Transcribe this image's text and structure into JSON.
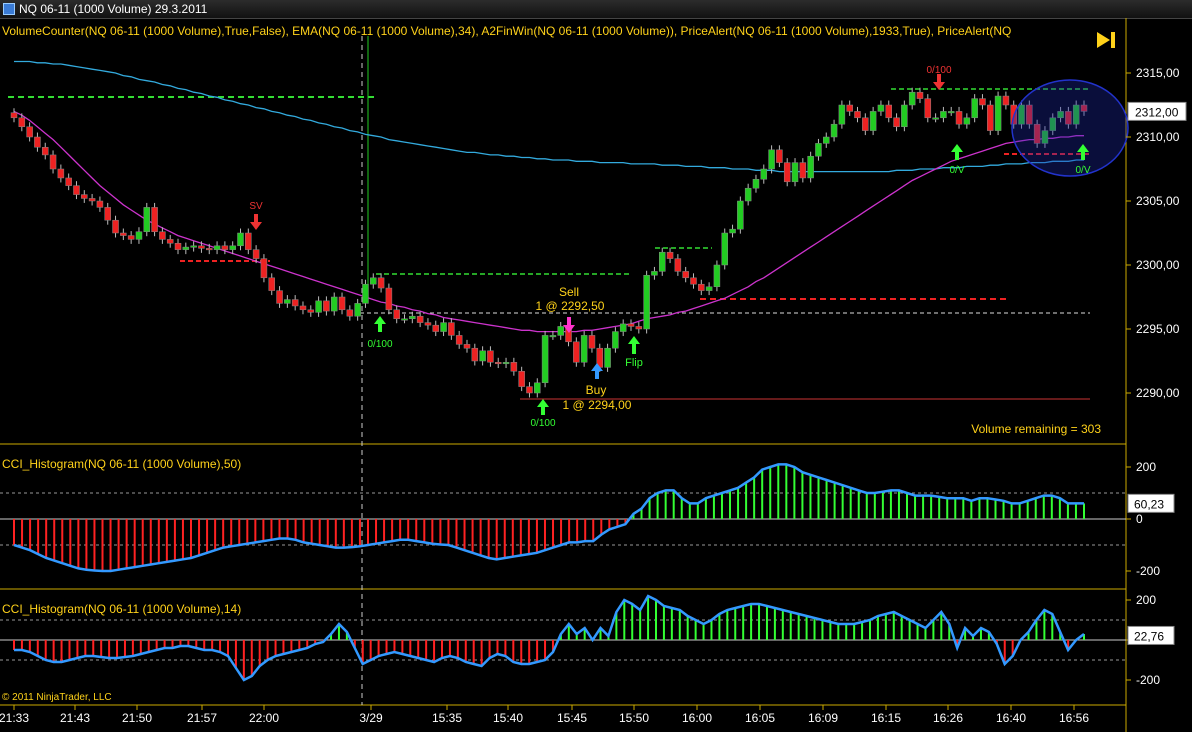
{
  "window": {
    "title": "NQ 06-11 (1000 Volume)  29.3.2011"
  },
  "panels": {
    "price_header": "VolumeCounter(NQ 06-11 (1000 Volume),True,False),  EMA(NQ 06-11 (1000 Volume),34),  A2FinWin(NQ 06-11 (1000 Volume)),  PriceAlert(NQ 06-11 (1000 Volume),1933,True),  PriceAlert(NQ",
    "cci50_header": "CCI_Histogram(NQ 06-11 (1000 Volume),50)",
    "cci14_header": "CCI_Histogram(NQ 06-11 (1000 Volume),14)",
    "copyright": "© 2011 NinjaTrader, LLC",
    "volume_remaining": "Volume remaining = 303"
  },
  "markers": {
    "sell_label": "Sell",
    "sell_detail": "1 @ 2292,50",
    "buy_label": "Buy",
    "buy_detail": "1 @ 2294,00",
    "flip": "Flip",
    "ov_a": "0/100",
    "ov_b": "0/100",
    "ov_c": "0/100",
    "ov_d": "0/V",
    "ov_e": "0/V",
    "sv": "SV"
  },
  "colors": {
    "bg": "#000000",
    "up_candle": "#22cc22",
    "down_candle": "#ee2222",
    "ema_fast": "#cc33cc",
    "ema_slow": "#33aadd",
    "cci_line": "#3399ff",
    "hist_pos": "#33ff33",
    "hist_neg": "#ff2222",
    "axis": "#ccaa00",
    "text": "#ffd21a"
  },
  "chart_data": [
    {
      "type": "candlestick",
      "panel": "price",
      "ylim": [
        2287,
        2317
      ],
      "y_ticks": [
        "2315,00",
        "2310,00",
        "2305,00",
        "2300,00",
        "2295,00",
        "2290,00"
      ],
      "last_price": "2312,00",
      "x_tick_labels": [
        "21:33",
        "21:43",
        "21:50",
        "21:57",
        "22:00",
        "3/29",
        "15:35",
        "15:40",
        "15:45",
        "15:50",
        "16:00",
        "16:05",
        "16:09",
        "16:15",
        "16:26",
        "16:40",
        "16:56"
      ],
      "closes": [
        2311.5,
        2310.8,
        2310.0,
        2309.2,
        2308.6,
        2307.5,
        2306.8,
        2306.2,
        2305.5,
        2305.2,
        2305.0,
        2304.5,
        2303.5,
        2302.5,
        2302.3,
        2302.0,
        2302.6,
        2304.5,
        2302.6,
        2302.0,
        2301.7,
        2301.2,
        2301.4,
        2301.5,
        2301.3,
        2301.2,
        2301.5,
        2301.2,
        2301.5,
        2302.5,
        2301.2,
        2300.5,
        2299.0,
        2298.0,
        2297.0,
        2297.3,
        2296.8,
        2296.5,
        2296.3,
        2297.2,
        2296.4,
        2297.5,
        2296.5,
        2296.0,
        2297.0,
        2298.5,
        2299.0,
        2298.2,
        2296.5,
        2295.8,
        2295.8,
        2296.0,
        2295.5,
        2295.3,
        2294.8,
        2295.5,
        2294.5,
        2293.8,
        2293.5,
        2292.5,
        2293.3,
        2292.4,
        2292.3,
        2292.4,
        2291.7,
        2290.5,
        2290.0,
        2290.8,
        2294.5,
        2294.5,
        2295.2,
        2294.0,
        2292.4,
        2294.5,
        2293.5,
        2292.0,
        2293.5,
        2294.8,
        2295.4,
        2295.2,
        2295.0,
        2299.2,
        2299.5,
        2301.0,
        2300.5,
        2299.5,
        2299.0,
        2298.5,
        2298.0,
        2298.3,
        2300.0,
        2302.5,
        2302.8,
        2305.0,
        2306.0,
        2306.7,
        2307.5,
        2309.0,
        2308.0,
        2306.5,
        2308.0,
        2306.8,
        2308.5,
        2309.5,
        2310.0,
        2311.0,
        2312.5,
        2312.0,
        2311.5,
        2310.5,
        2312.0,
        2312.5,
        2311.5,
        2310.8,
        2312.5,
        2313.5,
        2313.0,
        2311.5,
        2311.5,
        2312.0,
        2312.0,
        2311.0,
        2311.5,
        2313.0,
        2312.5,
        2310.5,
        2313.2,
        2312.5,
        2311.0,
        2312.5,
        2311.0,
        2309.5,
        2310.5,
        2311.5,
        2312.0,
        2311.0,
        2312.5,
        2312.0
      ],
      "ema_fast": [
        2312.0,
        2311.7,
        2311.3,
        2310.8,
        2310.3,
        2309.8,
        2309.2,
        2308.6,
        2308.0,
        2307.4,
        2306.8,
        2306.2,
        2305.7,
        2305.2,
        2304.7,
        2304.3,
        2303.9,
        2303.5,
        2303.2,
        2302.9,
        2302.6,
        2302.3,
        2302.1,
        2301.9,
        2301.7,
        2301.5,
        2301.3,
        2301.1,
        2300.9,
        2300.7,
        2300.5,
        2300.3,
        2300.1,
        2299.9,
        2299.7,
        2299.5,
        2299.3,
        2299.1,
        2298.9,
        2298.7,
        2298.5,
        2298.3,
        2298.1,
        2297.9,
        2297.7,
        2297.5,
        2297.3,
        2297.1,
        2297.0,
        2296.8,
        2296.7,
        2296.5,
        2296.4,
        2296.2,
        2296.1,
        2295.9,
        2295.8,
        2295.7,
        2295.6,
        2295.5,
        2295.4,
        2295.3,
        2295.2,
        2295.1,
        2295.0,
        2294.9,
        2294.9,
        2294.8,
        2294.8,
        2294.8,
        2294.8,
        2294.8,
        2294.8,
        2294.9,
        2294.9,
        2295.0,
        2295.1,
        2295.2,
        2295.3,
        2295.4,
        2295.6,
        2295.8,
        2295.9,
        2296.0,
        2296.1,
        2296.3,
        2296.4,
        2296.6,
        2296.8,
        2297.0,
        2297.2,
        2297.4,
        2297.7,
        2298.0,
        2298.3,
        2298.7,
        2299.0,
        2299.4,
        2299.8,
        2300.2,
        2300.6,
        2301.0,
        2301.4,
        2301.8,
        2302.2,
        2302.6,
        2303.0,
        2303.4,
        2303.8,
        2304.2,
        2304.6,
        2305.0,
        2305.4,
        2305.8,
        2306.2,
        2306.6,
        2306.9,
        2307.2,
        2307.5,
        2307.8,
        2308.1,
        2308.3,
        2308.5,
        2308.7,
        2308.9,
        2309.1,
        2309.3,
        2309.5,
        2309.6,
        2309.7,
        2309.8,
        2309.8,
        2309.9,
        2309.9,
        2310.0,
        2310.0,
        2310.1,
        2310.1
      ],
      "ema_slow": [
        2315.9,
        2315.9,
        2315.9,
        2315.8,
        2315.8,
        2315.7,
        2315.7,
        2315.6,
        2315.5,
        2315.4,
        2315.3,
        2315.2,
        2315.1,
        2315.0,
        2314.8,
        2314.7,
        2314.5,
        2314.4,
        2314.3,
        2314.1,
        2314.0,
        2313.8,
        2313.7,
        2313.5,
        2313.4,
        2313.2,
        2313.1,
        2312.9,
        2312.8,
        2312.6,
        2312.5,
        2312.3,
        2312.2,
        2312.0,
        2311.9,
        2311.7,
        2311.6,
        2311.4,
        2311.3,
        2311.1,
        2311.0,
        2310.8,
        2310.7,
        2310.5,
        2310.4,
        2310.2,
        2310.1,
        2310.0,
        2309.8,
        2309.7,
        2309.6,
        2309.5,
        2309.4,
        2309.3,
        2309.2,
        2309.1,
        2309.0,
        2308.9,
        2308.8,
        2308.8,
        2308.7,
        2308.6,
        2308.6,
        2308.5,
        2308.5,
        2308.4,
        2308.4,
        2308.3,
        2308.3,
        2308.2,
        2308.2,
        2308.2,
        2308.1,
        2308.1,
        2308.1,
        2308.0,
        2308.0,
        2308.0,
        2308.0,
        2307.9,
        2307.9,
        2307.9,
        2307.9,
        2307.8,
        2307.8,
        2307.8,
        2307.7,
        2307.7,
        2307.7,
        2307.6,
        2307.6,
        2307.6,
        2307.5,
        2307.5,
        2307.5,
        2307.4,
        2307.4,
        2307.4,
        2307.3,
        2307.3,
        2307.3,
        2307.3,
        2307.3,
        2307.3,
        2307.3,
        2307.3,
        2307.3,
        2307.3,
        2307.3,
        2307.3,
        2307.3,
        2307.3,
        2307.3,
        2307.4,
        2307.4,
        2307.4,
        2307.5,
        2307.5,
        2307.5,
        2307.6,
        2307.6,
        2307.6,
        2307.7,
        2307.7,
        2307.7,
        2307.8,
        2307.8,
        2307.9,
        2307.9,
        2307.9,
        2308.0,
        2308.0,
        2308.0,
        2308.1,
        2308.1,
        2308.1,
        2308.2,
        2308.2
      ]
    },
    {
      "type": "bar",
      "panel": "cci50",
      "ylim": [
        -250,
        250
      ],
      "y_ticks": [
        "200",
        "0",
        "-200"
      ],
      "last_value": "60,23",
      "values": [
        -100,
        -110,
        -120,
        -135,
        -150,
        -160,
        -170,
        -180,
        -190,
        -195,
        -198,
        -200,
        -200,
        -195,
        -190,
        -185,
        -180,
        -175,
        -170,
        -165,
        -160,
        -155,
        -150,
        -140,
        -130,
        -120,
        -110,
        -105,
        -100,
        -95,
        -90,
        -85,
        -80,
        -75,
        -75,
        -80,
        -90,
        -95,
        -100,
        -105,
        -110,
        -110,
        -108,
        -105,
        -100,
        -95,
        -90,
        -85,
        -80,
        -80,
        -85,
        -90,
        -95,
        -98,
        -100,
        -110,
        -120,
        -130,
        -140,
        -150,
        -155,
        -150,
        -145,
        -140,
        -135,
        -130,
        -120,
        -110,
        -100,
        -90,
        -90,
        -85,
        -85,
        -60,
        -40,
        -30,
        -20,
        20,
        40,
        80,
        100,
        110,
        110,
        80,
        60,
        60,
        80,
        90,
        100,
        110,
        120,
        140,
        160,
        190,
        200,
        210,
        210,
        200,
        180,
        170,
        160,
        150,
        140,
        130,
        120,
        110,
        100,
        100,
        105,
        110,
        110,
        100,
        90,
        90,
        90,
        85,
        80,
        80,
        80,
        70,
        80,
        80,
        75,
        70,
        60,
        60,
        70,
        80,
        90,
        90,
        80,
        60,
        60,
        60
      ]
    },
    {
      "type": "bar",
      "panel": "cci14",
      "ylim": [
        -260,
        260
      ],
      "y_ticks": [
        "200",
        "0",
        "-200"
      ],
      "last_value": "22,76",
      "values": [
        -50,
        -50,
        -60,
        -80,
        -100,
        -110,
        -110,
        -100,
        -90,
        -80,
        -80,
        -85,
        -90,
        -90,
        -85,
        -80,
        -70,
        -60,
        -50,
        -40,
        -40,
        -30,
        -30,
        -40,
        -50,
        -50,
        -60,
        -80,
        -140,
        -200,
        -180,
        -130,
        -100,
        -80,
        -70,
        -60,
        -50,
        -40,
        -20,
        -10,
        30,
        80,
        40,
        -40,
        -120,
        -100,
        -80,
        -70,
        -60,
        -70,
        -80,
        -90,
        -100,
        -110,
        -90,
        -80,
        -90,
        -110,
        -120,
        -130,
        -90,
        -70,
        -80,
        -110,
        -120,
        -120,
        -110,
        -100,
        -60,
        30,
        80,
        30,
        60,
        0,
        60,
        20,
        140,
        200,
        180,
        150,
        220,
        200,
        170,
        160,
        150,
        120,
        100,
        80,
        100,
        130,
        150,
        160,
        170,
        180,
        180,
        170,
        160,
        150,
        140,
        130,
        120,
        110,
        100,
        90,
        80,
        80,
        80,
        90,
        100,
        120,
        130,
        140,
        120,
        100,
        80,
        60,
        100,
        140,
        80,
        -40,
        60,
        20,
        60,
        40,
        -20,
        -120,
        -80,
        0,
        40,
        100,
        150,
        130,
        40,
        -50,
        0,
        30
      ]
    }
  ]
}
